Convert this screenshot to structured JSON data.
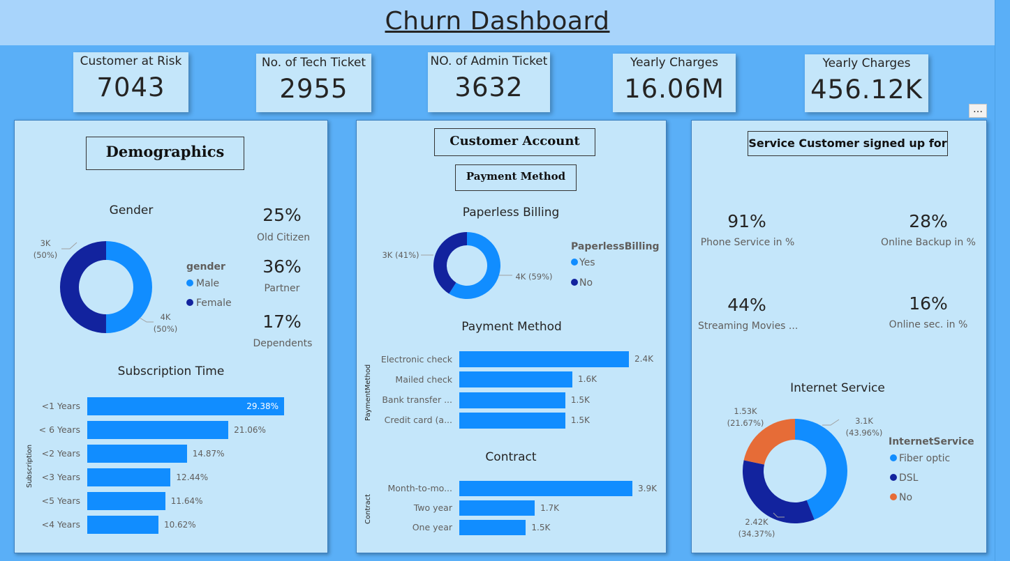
{
  "header": {
    "title": "Churn Dashboard"
  },
  "kpis": [
    {
      "label": "Customer at Risk",
      "value": "7043"
    },
    {
      "label": "No. of Tech Ticket",
      "value": "2955"
    },
    {
      "label": "NO. of Admin Ticket",
      "value": "3632"
    },
    {
      "label": "Yearly Charges",
      "value": "16.06M"
    },
    {
      "label": "Yearly Charges",
      "value": "456.12K"
    }
  ],
  "demographics": {
    "heading": "Demographics",
    "gender": {
      "title": "Gender",
      "legend_title": "gender",
      "legend": [
        "Male",
        "Female"
      ],
      "label_female": [
        "3K",
        "(50%)"
      ],
      "label_male": [
        "4K",
        "(50%)"
      ]
    },
    "stats": [
      {
        "value": "25%",
        "label": "Old Citizen"
      },
      {
        "value": "36%",
        "label": "Partner"
      },
      {
        "value": "17%",
        "label": "Dependents"
      }
    ],
    "subscription": {
      "title": "Subscription Time",
      "axis_label": "Subscription"
    }
  },
  "account": {
    "heading": "Customer Account",
    "subheading": "Payment Method",
    "paperless": {
      "title": "Paperless Billing",
      "legend_title": "PaperlessBilling",
      "legend": [
        "Yes",
        "No"
      ],
      "label_no": "3K (41%)",
      "label_yes": "4K (59%)"
    },
    "payment": {
      "title": "Payment Method",
      "axis_label": "PaymentMethod"
    },
    "contract": {
      "title": "Contract",
      "axis_label": "Contract"
    }
  },
  "services": {
    "heading": "Service Customer signed up for",
    "stats": [
      {
        "value": "91%",
        "label": "Phone Service in %"
      },
      {
        "value": "28%",
        "label": "Online Backup in %"
      },
      {
        "value": "44%",
        "label": "Streaming Movies ..."
      },
      {
        "value": "16%",
        "label": "Online sec. in %"
      }
    ],
    "internet": {
      "title": "Internet Service",
      "legend_title": "InternetService",
      "legend": [
        "Fiber optic",
        "DSL",
        "No"
      ],
      "label_fiber": [
        "3.1K",
        "(43.96%)"
      ],
      "label_dsl": [
        "2.42K",
        "(34.37%)"
      ],
      "label_no": [
        "1.53K",
        "(21.67%)"
      ]
    }
  },
  "colors": {
    "primary": "#118dff",
    "dark": "#12239e",
    "orange": "#e66c37"
  },
  "more_icon": "…",
  "chart_data": [
    {
      "type": "pie",
      "title": "Gender",
      "categories": [
        "Male",
        "Female"
      ],
      "values": [
        3522,
        3521
      ],
      "labels": [
        "4K (50%)",
        "3K (50%)"
      ],
      "colors": [
        "#118dff",
        "#12239e"
      ]
    },
    {
      "type": "bar",
      "title": "Subscription Time",
      "ylabel": "Subscription",
      "categories": [
        "<1 Years",
        "< 6 Years",
        "<2 Years",
        "<3 Years",
        "<5 Years",
        "<4 Years"
      ],
      "values": [
        29.38,
        21.06,
        14.87,
        12.44,
        11.64,
        10.62
      ],
      "labels": [
        "29.38%",
        "21.06%",
        "14.87%",
        "12.44%",
        "11.64%",
        "10.62%"
      ],
      "xlim": [
        0,
        30
      ]
    },
    {
      "type": "pie",
      "title": "Paperless Billing",
      "categories": [
        "Yes",
        "No"
      ],
      "values": [
        59,
        41
      ],
      "labels": [
        "4K (59%)",
        "3K (41%)"
      ],
      "colors": [
        "#118dff",
        "#12239e"
      ]
    },
    {
      "type": "bar",
      "title": "Payment Method",
      "ylabel": "PaymentMethod",
      "categories": [
        "Electronic check",
        "Mailed check",
        "Bank transfer ...",
        "Credit card (a..."
      ],
      "values": [
        2.4,
        1.6,
        1.5,
        1.5
      ],
      "labels": [
        "2.4K",
        "1.6K",
        "1.5K",
        "1.5K"
      ],
      "xlim": [
        0,
        2.8
      ]
    },
    {
      "type": "bar",
      "title": "Contract",
      "ylabel": "Contract",
      "categories": [
        "Month-to-mo...",
        "Two year",
        "One year"
      ],
      "values": [
        3.9,
        1.7,
        1.5
      ],
      "labels": [
        "3.9K",
        "1.7K",
        "1.5K"
      ],
      "xlim": [
        0,
        4.2
      ]
    },
    {
      "type": "pie",
      "title": "Internet Service",
      "categories": [
        "Fiber optic",
        "DSL",
        "No"
      ],
      "values": [
        43.96,
        34.37,
        21.67
      ],
      "colors": [
        "#118dff",
        "#12239e",
        "#e66c37"
      ]
    }
  ]
}
